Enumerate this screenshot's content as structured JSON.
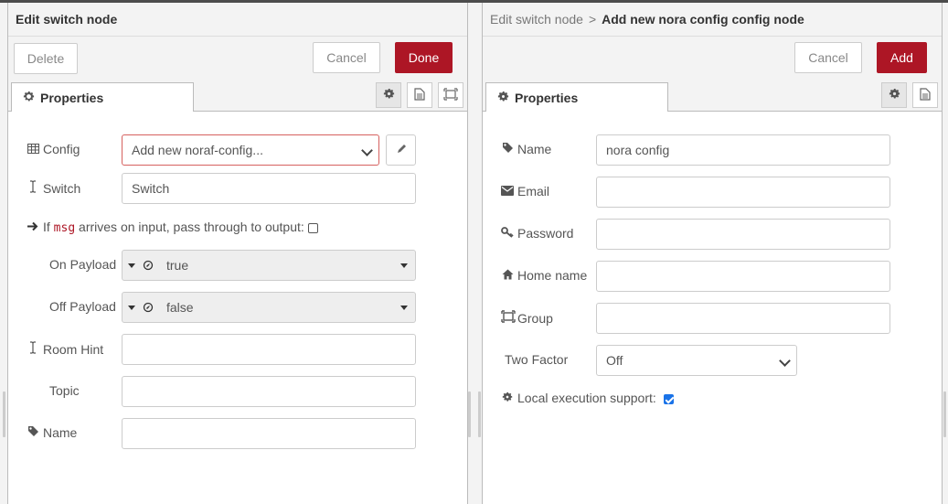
{
  "left": {
    "title": "Edit switch node",
    "delete_label": "Delete",
    "cancel_label": "Cancel",
    "done_label": "Done",
    "tab_label": "Properties",
    "config": {
      "label": "Config",
      "value": "Add new noraf-config...",
      "edit_icon": "pencil-icon"
    },
    "switch": {
      "label": "Switch",
      "value": "Switch"
    },
    "passthrough": {
      "prefix": "If",
      "code": "msg",
      "suffix": "arrives on input, pass through to output:",
      "checked": false
    },
    "on_payload": {
      "label": "On Payload",
      "value": "true"
    },
    "off_payload": {
      "label": "Off Payload",
      "value": "false"
    },
    "room_hint": {
      "label": "Room Hint",
      "value": ""
    },
    "topic": {
      "label": "Topic",
      "value": ""
    },
    "name": {
      "label": "Name",
      "value": ""
    }
  },
  "right": {
    "breadcrumb_parent": "Edit switch node",
    "breadcrumb_sep": ">",
    "title": "Add new nora config config node",
    "cancel_label": "Cancel",
    "add_label": "Add",
    "tab_label": "Properties",
    "name": {
      "label": "Name",
      "value": "nora config"
    },
    "email": {
      "label": "Email",
      "value": ""
    },
    "password": {
      "label": "Password",
      "value": ""
    },
    "home_name": {
      "label": "Home name",
      "value": ""
    },
    "group": {
      "label": "Group",
      "value": ""
    },
    "two_factor": {
      "label": "Two Factor",
      "value": "Off"
    },
    "local_exec": {
      "label": "Local execution support:",
      "checked": true
    }
  },
  "colors": {
    "primary": "#ad1625",
    "error_border": "#d6615f",
    "checkbox": "#1a73e8"
  }
}
